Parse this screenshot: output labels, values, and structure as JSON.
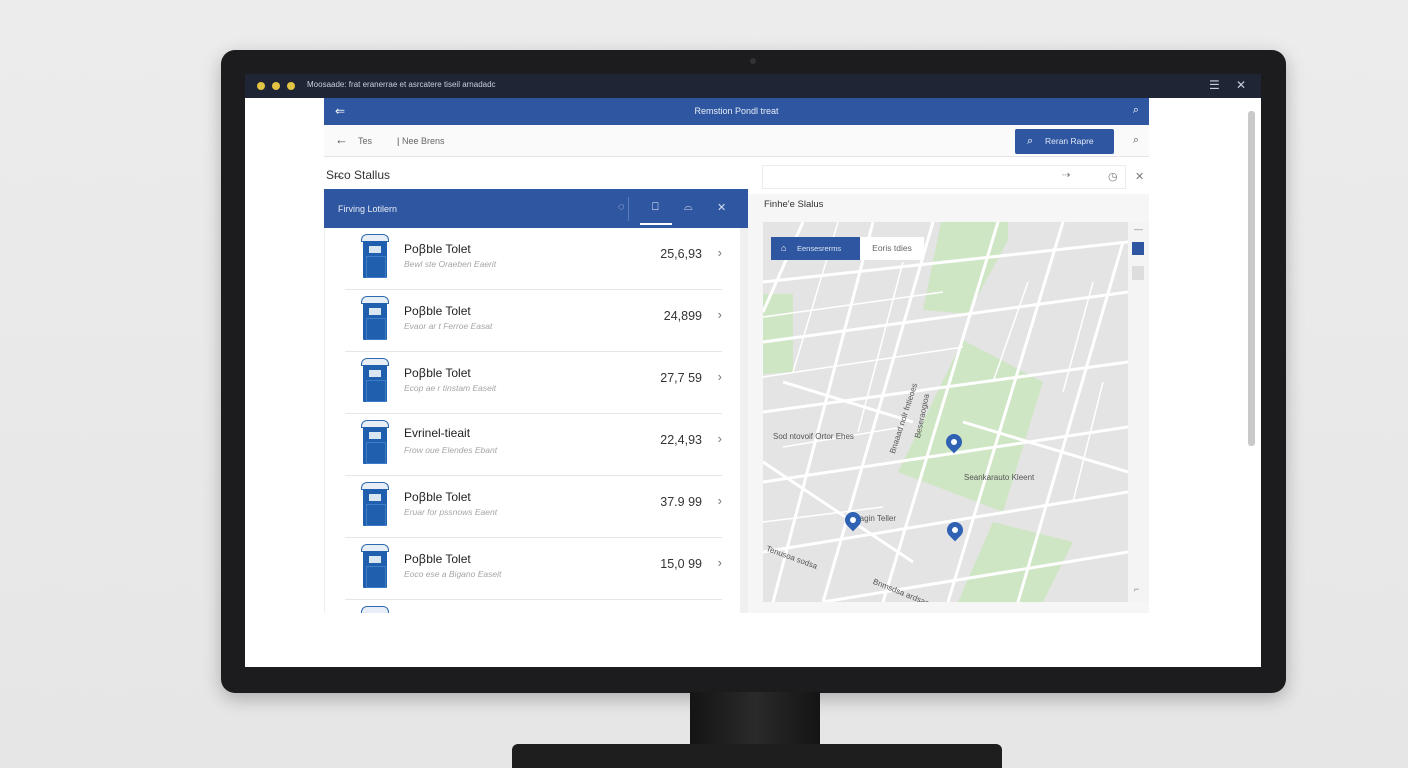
{
  "os": {
    "title": "Moosaade: frat eranerrae et asrcatere tiseil arnadadc",
    "menu_icon": "☰",
    "close_icon": "✕"
  },
  "app": {
    "title": "Remstion Pondl treat",
    "nav_icon": "⇐",
    "search_icon": "⌕"
  },
  "subbar": {
    "back_icon": "←",
    "crumb1": "Tes",
    "crumb2": "Nee  Brens",
    "find_button": "Reran Rapre",
    "find_icon": "⌕",
    "extra_icon": "⌕"
  },
  "section_title": "Sr̶co Stallus",
  "left_panel": {
    "title": "Firving Lotilern",
    "icons": [
      "◌",
      "⎕",
      "⌓",
      "✕"
    ]
  },
  "items": [
    {
      "title": "Poꞵble Tolet",
      "subtitle": "Bewl ste Oraeben Eaerit",
      "value": "25,6,93"
    },
    {
      "title": "Poꞵble Tolet",
      "subtitle": "Evaor ar t Ferroe Easat",
      "value": "24,899"
    },
    {
      "title": "Poꞵble Tolet",
      "subtitle": "Ecop ae r tinstam Easeit",
      "value": "27,7 59"
    },
    {
      "title": "Evrinel-tieait",
      "subtitle": "Frow oue Elendes Ebant",
      "value": "22,4,93"
    },
    {
      "title": "Poꞵble Tolet",
      "subtitle": "Eruar for pssnows Eaent",
      "value": "37.9 99"
    },
    {
      "title": "Poꞵble Tolet",
      "subtitle": "Eoco ese a Bigano Easeit",
      "value": "15,0 99"
    }
  ],
  "right_panel": {
    "title": "Finhe'e Slalus",
    "bar_icon_1": "⇢",
    "bar_icon_2": "◷",
    "close_icon": "✕",
    "chip_active": "Eensesrerms",
    "chip_active_icon": "⌂",
    "chip": "Eoris tdies",
    "side_dash_top": "—",
    "side_dash_bottom": "⌐"
  },
  "map": {
    "labels": {
      "street1": "Sod ntovoif Ortor Ehes",
      "street2": "Seankarauto Kleent",
      "street3": "Magin Teller",
      "road1": "Bnaaad nolr fntieoes",
      "road2": "Tenusoa sodsa",
      "road3": "Bnmsdsa ardsae",
      "road4": "Beseraogioa"
    },
    "colors": {
      "park": "#cfe6c4",
      "road": "#ffffff",
      "land": "#e4e4e4",
      "pin": "#2f62b3"
    }
  }
}
